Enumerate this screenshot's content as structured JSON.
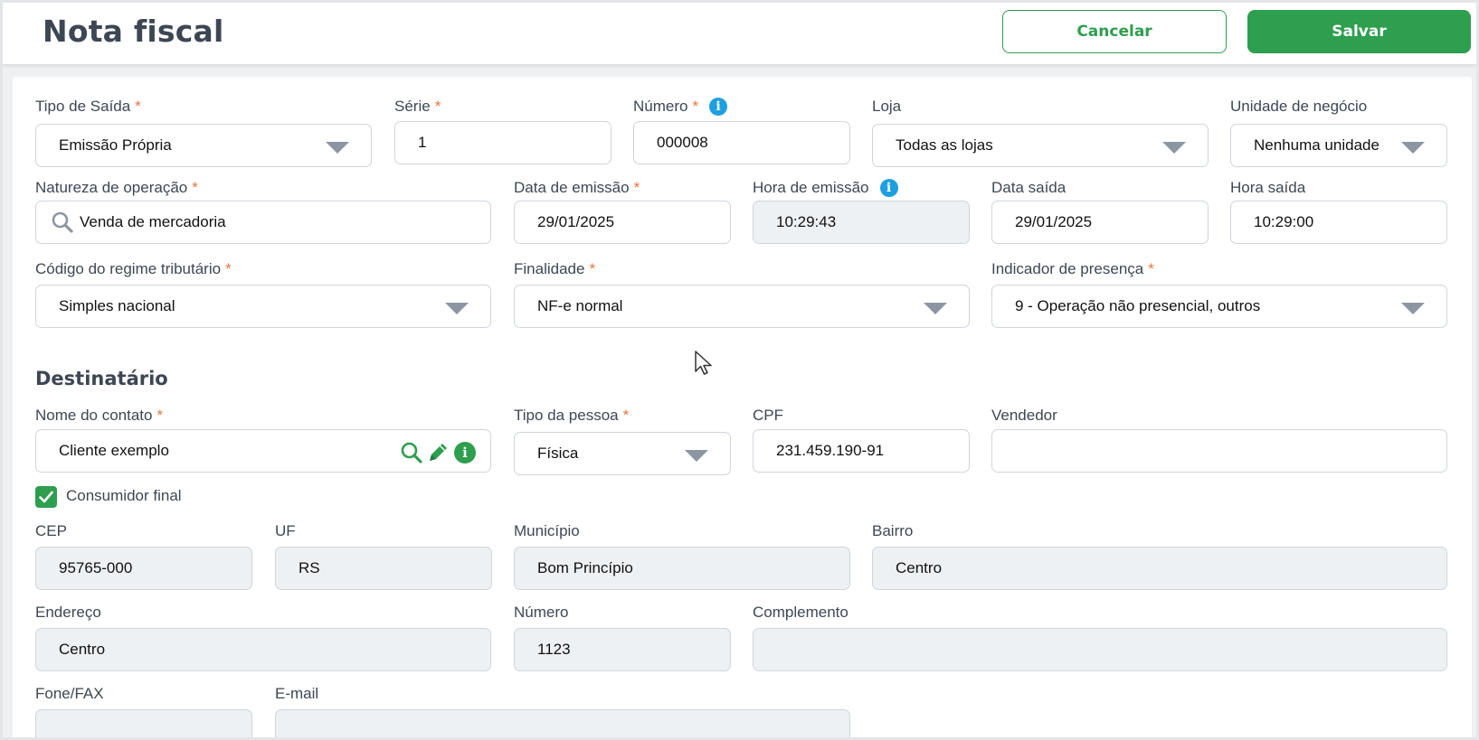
{
  "header": {
    "title": "Nota fiscal",
    "cancel_label": "Cancelar",
    "save_label": "Salvar"
  },
  "form": {
    "tipo_saida": {
      "label": "Tipo de Saída",
      "value": "Emissão Própria"
    },
    "serie": {
      "label": "Série",
      "value": "1"
    },
    "numero": {
      "label": "Número",
      "value": "000008"
    },
    "loja": {
      "label": "Loja",
      "value": "Todas as lojas"
    },
    "unidade_negocio": {
      "label": "Unidade de negócio",
      "value": "Nenhuma unidade"
    },
    "natureza_operacao": {
      "label": "Natureza de operação",
      "value": "Venda de mercadoria"
    },
    "data_emissao": {
      "label": "Data de emissão",
      "value": "29/01/2025"
    },
    "hora_emissao": {
      "label": "Hora de emissão",
      "value": "10:29:43"
    },
    "data_saida": {
      "label": "Data saída",
      "value": "29/01/2025"
    },
    "hora_saida": {
      "label": "Hora saída",
      "value": "10:29:00"
    },
    "regime_tributario": {
      "label": "Código do regime tributário",
      "value": "Simples nacional"
    },
    "finalidade": {
      "label": "Finalidade",
      "value": "NF-e normal"
    },
    "indicador_presenca": {
      "label": "Indicador de presença",
      "value": "9 - Operação não presencial, outros"
    }
  },
  "destinatario": {
    "title": "Destinatário",
    "nome_contato": {
      "label": "Nome do contato",
      "value": "Cliente exemplo"
    },
    "tipo_pessoa": {
      "label": "Tipo da pessoa",
      "value": "Física"
    },
    "cpf": {
      "label": "CPF",
      "value": "231.459.190-91"
    },
    "vendedor": {
      "label": "Vendedor",
      "value": ""
    },
    "consumidor_final": {
      "label": "Consumidor final",
      "checked": true
    },
    "cep": {
      "label": "CEP",
      "value": "95765-000"
    },
    "uf": {
      "label": "UF",
      "value": "RS"
    },
    "municipio": {
      "label": "Município",
      "value": "Bom Princípio"
    },
    "bairro": {
      "label": "Bairro",
      "value": "Centro"
    },
    "endereco": {
      "label": "Endereço",
      "value": "Centro"
    },
    "numero": {
      "label": "Número",
      "value": "1123"
    },
    "complemento": {
      "label": "Complemento",
      "value": ""
    },
    "fone_fax": {
      "label": "Fone/FAX",
      "value": ""
    },
    "email": {
      "label": "E-mail",
      "value": ""
    }
  },
  "required_mark": "*",
  "colors": {
    "primary": "#2e9e4f",
    "info": "#1e9fe0",
    "required": "#e8743b",
    "readonly_bg": "#eef1f4"
  }
}
